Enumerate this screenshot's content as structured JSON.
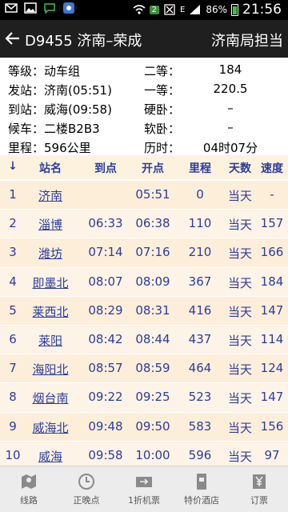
{
  "status_bar": {
    "battery": "86%",
    "time": "21:56",
    "badge": "2",
    "mail_letter": "E"
  },
  "header": {
    "title": "D9455 济南–荣成",
    "bureau": "济南局担当"
  },
  "info": [
    {
      "left_label": "等级：",
      "left_value": "动车组",
      "right_label": "二等：",
      "right_value": "184"
    },
    {
      "left_label": "发站：",
      "left_value": "济南(05:51)",
      "right_label": "一等：",
      "right_value": "220.5"
    },
    {
      "left_label": "到站：",
      "left_value": "威海(09:58)",
      "right_label": "硬卧：",
      "right_value": "–"
    },
    {
      "left_label": "候车：",
      "left_value": "二楼B2B3",
      "right_label": "软卧：",
      "right_value": "–"
    },
    {
      "left_label": "里程：",
      "left_value": "596公里",
      "right_label": "历时：",
      "right_value": "04时07分"
    }
  ],
  "table": {
    "columns": [
      "↓",
      "站名",
      "到点",
      "开点",
      "里程",
      "天数",
      "速度"
    ],
    "rows": [
      {
        "no": "1",
        "station": "济南",
        "arrive": "",
        "depart": "05:51",
        "km": "0",
        "day": "当天",
        "speed": "-"
      },
      {
        "no": "2",
        "station": "淄博",
        "arrive": "06:33",
        "depart": "06:38",
        "km": "110",
        "day": "当天",
        "speed": "157"
      },
      {
        "no": "3",
        "station": "潍坊",
        "arrive": "07:14",
        "depart": "07:16",
        "km": "210",
        "day": "当天",
        "speed": "166"
      },
      {
        "no": "4",
        "station": "即墨北",
        "arrive": "08:07",
        "depart": "08:09",
        "km": "367",
        "day": "当天",
        "speed": "184"
      },
      {
        "no": "5",
        "station": "莱西北",
        "arrive": "08:29",
        "depart": "08:31",
        "km": "416",
        "day": "当天",
        "speed": "147"
      },
      {
        "no": "6",
        "station": "莱阳",
        "arrive": "08:42",
        "depart": "08:44",
        "km": "437",
        "day": "当天",
        "speed": "114"
      },
      {
        "no": "7",
        "station": "海阳北",
        "arrive": "08:57",
        "depart": "08:59",
        "km": "464",
        "day": "当天",
        "speed": "124"
      },
      {
        "no": "8",
        "station": "烟台南",
        "arrive": "09:22",
        "depart": "09:25",
        "km": "523",
        "day": "当天",
        "speed": "147"
      },
      {
        "no": "9",
        "station": "威海北",
        "arrive": "09:48",
        "depart": "09:50",
        "km": "583",
        "day": "当天",
        "speed": "156"
      },
      {
        "no": "10",
        "station": "威海",
        "arrive": "09:58",
        "depart": "10:00",
        "km": "596",
        "day": "当天",
        "speed": "97"
      }
    ]
  },
  "bottom_nav": [
    {
      "label": "线路",
      "icon": "map-icon"
    },
    {
      "label": "正晚点",
      "icon": "clock-icon"
    },
    {
      "label": "1折机票",
      "icon": "ticket-icon"
    },
    {
      "label": "特价酒店",
      "icon": "hotel-icon"
    },
    {
      "label": "订票",
      "icon": "yen-icon"
    }
  ]
}
